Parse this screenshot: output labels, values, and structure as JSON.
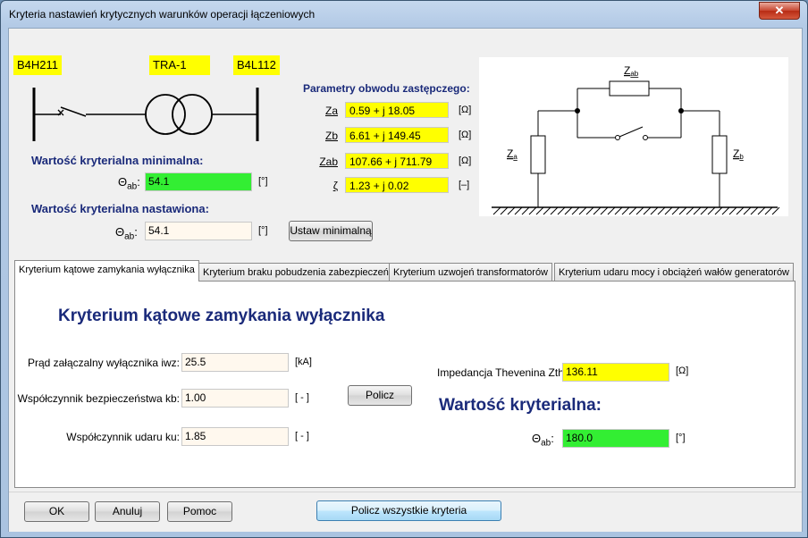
{
  "window": {
    "title": "Kryteria nastawień krytycznych warunków operacji łączeniowych",
    "close_glyph": "✕"
  },
  "scheme": {
    "left_node": "B4H211",
    "transformer": "TRA-1",
    "right_node": "B4L112"
  },
  "params": {
    "title": "Parametry obwodu zastępczego:",
    "rows": [
      {
        "label": "Za",
        "value": "0.59 + j 18.05",
        "unit": "[Ω]"
      },
      {
        "label": "Zb",
        "value": "6.61 + j 149.45",
        "unit": "[Ω]"
      },
      {
        "label": "Zab",
        "value": "107.66 + j 711.79",
        "unit": "[Ω]"
      },
      {
        "label": "ζ",
        "value": "1.23 + j 0.02",
        "unit": "[–]"
      }
    ]
  },
  "circuit": {
    "label_zab": "Z",
    "label_zab_sub": "ab",
    "label_za": "Z",
    "label_za_sub": "a",
    "label_zb": "Z",
    "label_zb_sub": "b"
  },
  "min_value": {
    "heading": "Wartość kryterialna minimalna:",
    "symbol": "Θ",
    "symbol_sub": "ab",
    "colon": ":",
    "value": "54.1",
    "unit": "[°]"
  },
  "set_value": {
    "heading": "Wartość kryterialna nastawiona:",
    "symbol": "Θ",
    "symbol_sub": "ab",
    "colon": ":",
    "value": "54.1",
    "unit": "[°]",
    "button": "Ustaw minimalną"
  },
  "tabs": [
    "Kryterium kątowe zamykania wyłącznika",
    "Kryterium braku pobudzenia zabezpieczeń",
    "Kryterium uzwojeń transformatorów",
    "Kryterium udaru mocy i obciążeń wałów generatorów"
  ],
  "panel": {
    "title": "Kryterium kątowe zamykania wyłącznika",
    "inputs": [
      {
        "label": "Prąd załączalny wyłącznika iwz:",
        "value": "25.5",
        "unit": "[kA]"
      },
      {
        "label": "Współczynnik bezpieczeństwa kb:",
        "value": "1.00",
        "unit": "[ - ]"
      },
      {
        "label": "Współczynnik udaru ku:",
        "value": "1.85",
        "unit": "[ - ]"
      }
    ],
    "compute_button": "Policz",
    "thevenin": {
      "label": "Impedancja Thevenina Zth:",
      "value": "136.11",
      "unit": "[Ω]"
    },
    "result_heading": "Wartość kryterialna:",
    "result": {
      "symbol": "Θ",
      "symbol_sub": "ab",
      "colon": ":",
      "value": "180.0",
      "unit": "[°]"
    }
  },
  "footer": {
    "ok": "OK",
    "cancel": "Anuluj",
    "help": "Pomoc",
    "compute_all": "Policz wszystkie kryteria"
  },
  "colors": {
    "yellow": "#ffff00",
    "green": "#33ee33",
    "input_bg": "#fff8ee",
    "heading_blue": "#1a2a7a"
  }
}
